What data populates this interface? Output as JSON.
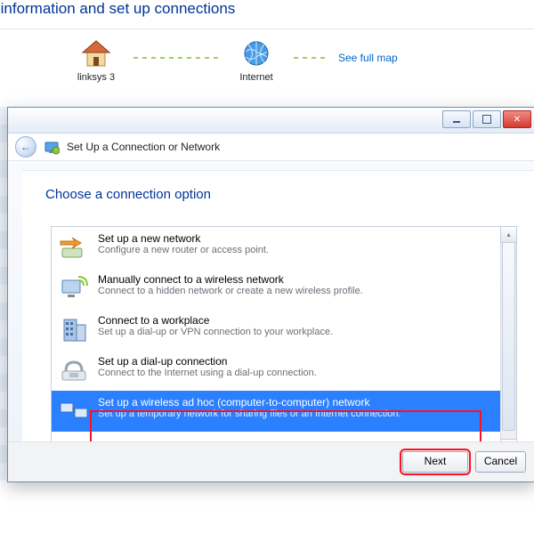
{
  "bg": {
    "title": "work information and set up connections",
    "see_full_map": "See full map",
    "node_home": "linksys 3",
    "node_internet": "Internet"
  },
  "wizard": {
    "back_glyph": "←",
    "icon_name": "shield-network-icon",
    "title": "Set Up a Connection or Network",
    "heading": "Choose a connection option",
    "options": [
      {
        "title": "Set up a new network",
        "desc": "Configure a new router or access point."
      },
      {
        "title": "Manually connect to a wireless network",
        "desc": "Connect to a hidden network or create a new wireless profile."
      },
      {
        "title": "Connect to a workplace",
        "desc": "Set up a dial-up or VPN connection to your workplace."
      },
      {
        "title": "Set up a dial-up connection",
        "desc": "Connect to the Internet using a dial-up connection."
      },
      {
        "title": "Set up a wireless ad hoc (computer-to-computer) network",
        "desc": "Set up a temporary network for sharing files or an Internet connection."
      }
    ],
    "selected_index": 4,
    "buttons": {
      "next": "Next",
      "cancel": "Cancel"
    },
    "scroll": {
      "up": "▴",
      "down": "▾"
    },
    "close_glyph": "✕"
  }
}
